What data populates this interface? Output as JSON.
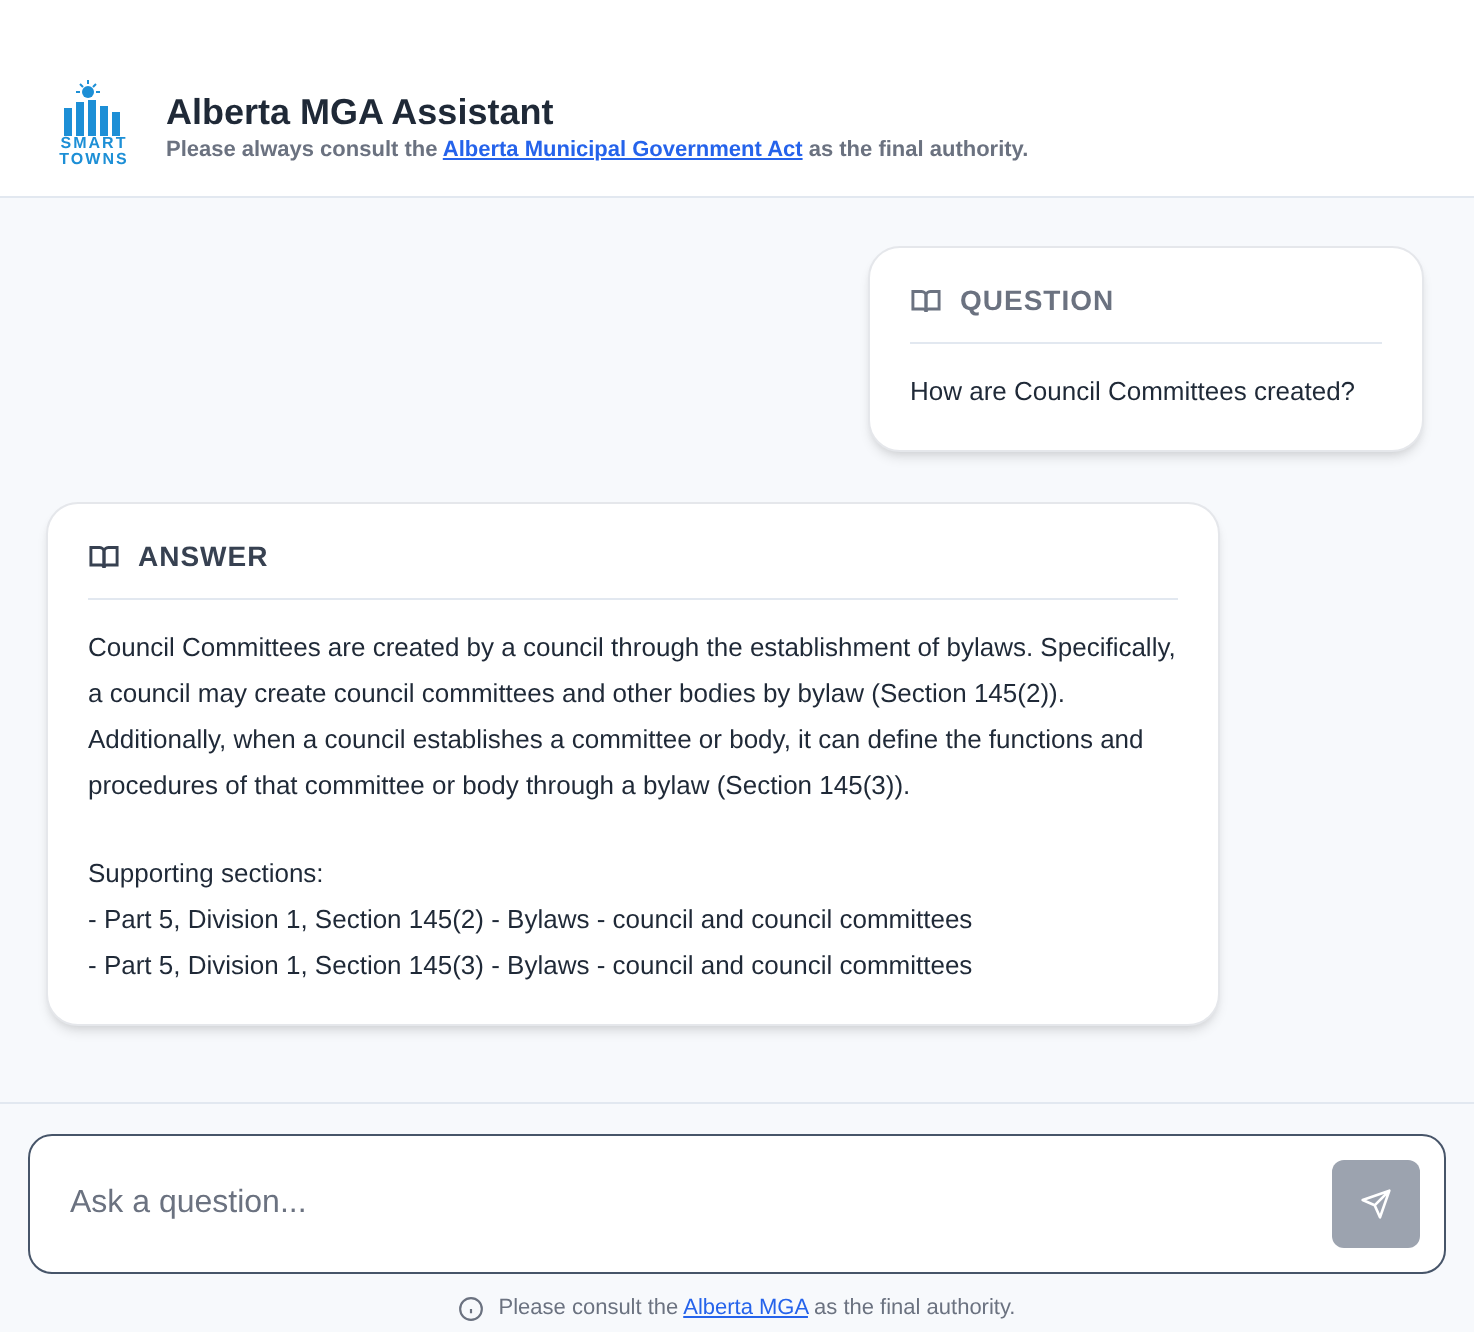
{
  "header": {
    "logo_text": [
      "SMART",
      "TOWNS"
    ],
    "title": "Alberta MGA Assistant",
    "subtitle": {
      "before": "Please always consult the ",
      "link": "Alberta Municipal Government Act",
      "after": " as the final authority."
    }
  },
  "messages": [
    {
      "kind": "question",
      "label": "QUESTION",
      "blocks": [
        [
          "How are Council Committees created?"
        ]
      ]
    },
    {
      "kind": "answer",
      "label": "ANSWER",
      "blocks": [
        [
          "Council Committees are created by a council through the establishment of bylaws. Specifically, a council may create council committees and other bodies by bylaw (Section 145(2)). Additionally, when a council establishes a committee or body, it can define the functions and procedures of that committee or body through a bylaw (Section 145(3))."
        ],
        [
          "Supporting sections:",
          "- Part 5, Division 1, Section 145(2) - Bylaws - council and council committees",
          "- Part 5, Division 1, Section 145(3) - Bylaws - council and council committees"
        ]
      ]
    }
  ],
  "input": {
    "placeholder": "Ask a question...",
    "send_disabled": true
  },
  "footer": {
    "before": "Please consult the ",
    "link": "Alberta MGA",
    "after": " as the final authority."
  }
}
